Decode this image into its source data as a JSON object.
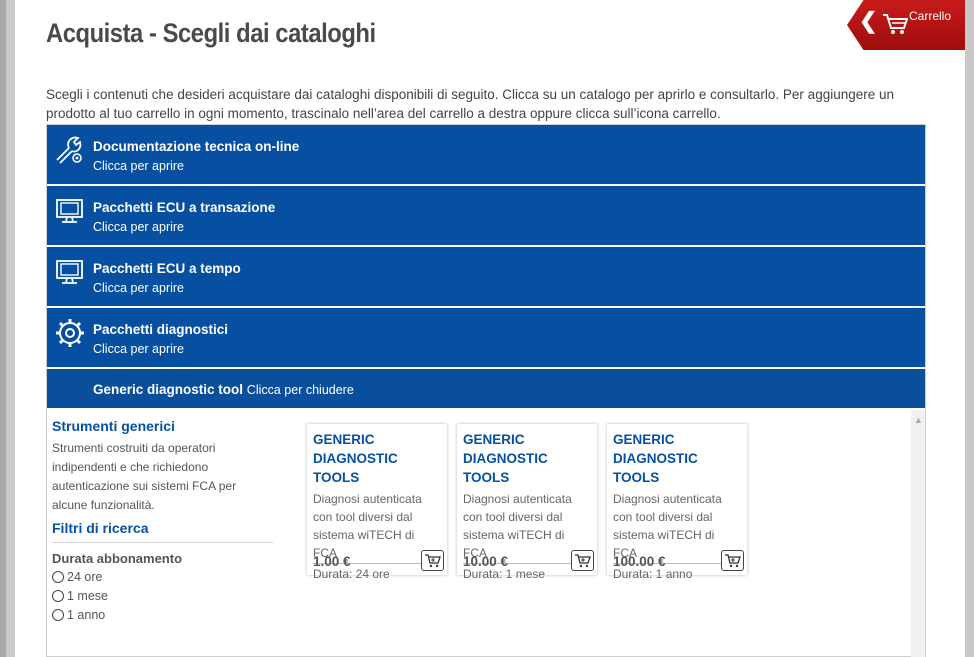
{
  "page": {
    "title": "Acquista - Scegli dai cataloghi",
    "intro": "Scegli i contenuti che desideri acquistare dai cataloghi disponibili di seguito. Clicca su un catalogo per aprirlo e consultarlo. Per aggiungere un prodotto al tuo carrello in ogni momento, trascinalo nell’area del carrello a destra oppure clicca sull’icona carrello."
  },
  "cart": {
    "label": "Carrello",
    "back_glyph": "❮"
  },
  "catalogs": [
    {
      "name": "Documentazione tecnica on-line",
      "hint": "Clicca per aprire",
      "icon": "wrench-icon"
    },
    {
      "name": "Pacchetti ECU a transazione",
      "hint": "Clicca per aprire",
      "icon": "monitor-icon"
    },
    {
      "name": "Pacchetti ECU a tempo",
      "hint": "Clicca per aprire",
      "icon": "monitor-icon"
    },
    {
      "name": "Pacchetti diagnostici",
      "hint": "Clicca per aprire",
      "icon": "gear-icon"
    }
  ],
  "open_catalog": {
    "name": "Generic diagnostic tool",
    "hint": "Clicca per chiudere"
  },
  "filters": {
    "title": "Strumenti generici",
    "description": "Strumenti costruiti da operatori indipendenti e che richiedono autenticazione sui sistemi FCA per alcune funzionalità.",
    "search_title": "Filtri di ricerca",
    "group_label": "Durata abbonamento",
    "options": [
      "24 ore",
      "1 mese",
      "1 anno"
    ]
  },
  "products": [
    {
      "title": "GENERIC DIAGNOSTIC TOOLS",
      "description": "Diagnosi autenticata con tool diversi dal sistema wiTECH di FCA",
      "duration": "Durata: 24 ore",
      "price": "1.00 €"
    },
    {
      "title": "GENERIC DIAGNOSTIC TOOLS",
      "description": "Diagnosi autenticata con tool diversi dal sistema wiTECH di FCA",
      "duration": "Durata: 1 mese",
      "price": "10.00 €"
    },
    {
      "title": "GENERIC DIAGNOSTIC TOOLS",
      "description": "Diagnosi autenticata con tool diversi dal sistema wiTECH di FCA",
      "duration": "Durata: 1 anno",
      "price": "100.00 €"
    }
  ],
  "colors": {
    "primary_blue": "#0750a1",
    "cart_red": "#b31414"
  }
}
